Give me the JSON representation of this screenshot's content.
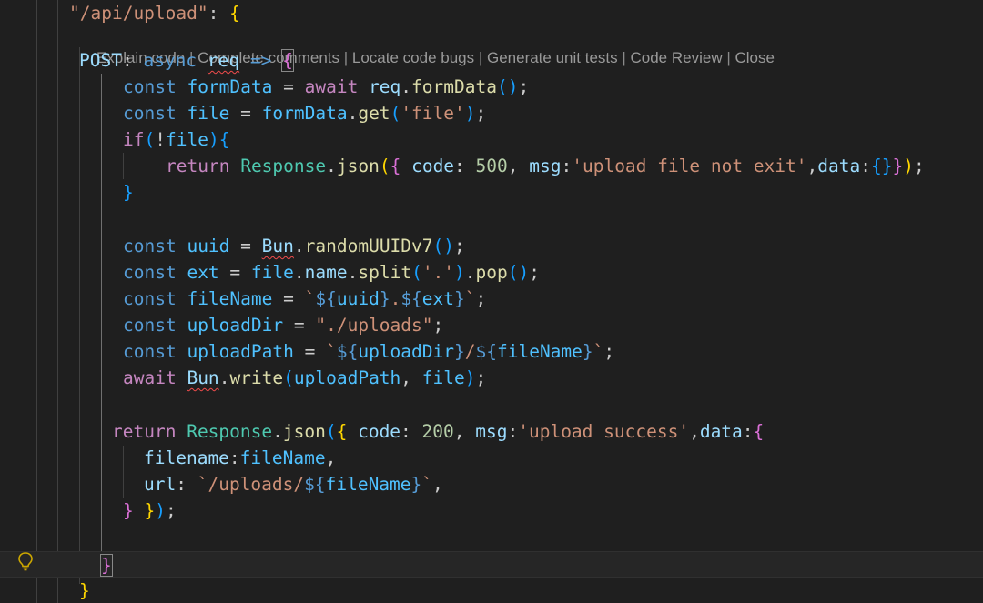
{
  "codelens": {
    "items": [
      "Explain code",
      "Complete comments",
      "Locate code bugs",
      "Generate unit tests",
      "Code Review",
      "Close"
    ],
    "separator": " | "
  },
  "code": {
    "l1_str": "\"/api/upload\"",
    "l1_colon": ": ",
    "l1_brace": "{",
    "l2_post": "POST",
    "l2_colon": ": ",
    "l2_async": "async",
    "l2_req": "req",
    "l2_arrow": "=>",
    "l2_brace": "{",
    "l3_const": "const",
    "l3_formData": "formData",
    "l3_eq": " = ",
    "l3_await": "await",
    "l3_req": "req",
    "l3_dot": ".",
    "l3_fn": "formData",
    "l3_parens": "()",
    "l3_semi": ";",
    "l4_const": "const",
    "l4_file": "file",
    "l4_eq": " = ",
    "l4_formData": "formData",
    "l4_dot": ".",
    "l4_get": "get",
    "l4_open": "(",
    "l4_arg": "'file'",
    "l4_close": ")",
    "l4_semi": ";",
    "l5_if": "if",
    "l5_open": "(",
    "l5_not": "!",
    "l5_file": "file",
    "l5_close": ")",
    "l5_brace": "{",
    "l6_return": "return",
    "l6_Response": "Response",
    "l6_dot": ".",
    "l6_json": "json",
    "l6_open": "(",
    "l6_brace": "{",
    "l6_code": " code",
    "l6_colon1": ": ",
    "l6_500": "500",
    "l6_comma1": ", ",
    "l6_msg": "msg",
    "l6_colon2": ":",
    "l6_msgstr": "'upload file not exit'",
    "l6_comma2": ",",
    "l6_data": "data",
    "l6_colon3": ":",
    "l6_obj": "{}",
    "l6_brace_close": "}",
    "l6_close": ")",
    "l6_semi": ";",
    "l7_brace": "}",
    "l9_const": "const",
    "l9_uuid": "uuid",
    "l9_eq": " = ",
    "l9_Bun": "Bun",
    "l9_dot": ".",
    "l9_fn": "randomUUIDv7",
    "l9_parens": "()",
    "l9_semi": ";",
    "l10_const": "const",
    "l10_ext": "ext",
    "l10_eq": " = ",
    "l10_file": "file",
    "l10_dot1": ".",
    "l10_name": "name",
    "l10_dot2": ".",
    "l10_split": "split",
    "l10_open": "(",
    "l10_arg": "'.'",
    "l10_close": ")",
    "l10_dot3": ".",
    "l10_pop": "pop",
    "l10_parens": "()",
    "l10_semi": ";",
    "l11_const": "const",
    "l11_fileName": "fileName",
    "l11_eq": " = ",
    "l11_tick1": "`",
    "l11_d1": "${",
    "l11_uuid": "uuid",
    "l11_c1": "}",
    "l11_dot": ".",
    "l11_d2": "${",
    "l11_ext": "ext",
    "l11_c2": "}",
    "l11_tick2": "`",
    "l11_semi": ";",
    "l12_const": "const",
    "l12_uploadDir": "uploadDir",
    "l12_eq": " = ",
    "l12_str": "\"./uploads\"",
    "l12_semi": ";",
    "l13_const": "const",
    "l13_uploadPath": "uploadPath",
    "l13_eq": " = ",
    "l13_tick1": "`",
    "l13_d1": "${",
    "l13_uploadDir": "uploadDir",
    "l13_c1": "}",
    "l13_slash": "/",
    "l13_d2": "${",
    "l13_fileName": "fileName",
    "l13_c2": "}",
    "l13_tick2": "`",
    "l13_semi": ";",
    "l14_await": "await",
    "l14_Bun": "Bun",
    "l14_dot": ".",
    "l14_write": "write",
    "l14_open": "(",
    "l14_uploadPath": "uploadPath",
    "l14_comma": ", ",
    "l14_file": "file",
    "l14_close": ")",
    "l14_semi": ";",
    "l16_return": "return",
    "l16_Response": "Response",
    "l16_dot": ".",
    "l16_json": "json",
    "l16_open": "(",
    "l16_brace": "{",
    "l16_code": " code",
    "l16_colon1": ": ",
    "l16_200": "200",
    "l16_comma1": ", ",
    "l16_msg": "msg",
    "l16_colon2": ":",
    "l16_msgstr": "'upload success'",
    "l16_comma2": ",",
    "l16_data": "data",
    "l16_colon3": ":",
    "l16_obj": "{",
    "l17_filename": "filename",
    "l17_colon": ":",
    "l17_fileName": "fileName",
    "l17_comma": ",",
    "l18_url": "url",
    "l18_colon": ": ",
    "l18_tick1": "`/uploads/",
    "l18_d": "${",
    "l18_fileName": "fileName",
    "l18_c": "}",
    "l18_tick2": "`",
    "l18_comma": ",",
    "l19_brace1": "}",
    "l19_brace2": "}",
    "l19_close": ")",
    "l19_semi": ";",
    "l21_brace": "}",
    "l22_brace": "}"
  },
  "colors": {
    "background": "#1f1f1f",
    "keyword": "#569cd6",
    "control": "#c586c0",
    "variable": "#9cdcfe",
    "constant": "#4fc1ff",
    "function": "#dcdcaa",
    "class": "#4ec9b0",
    "string": "#ce9178",
    "number": "#b5cea8",
    "bracket1": "#ffd700",
    "bracket2": "#da70d6",
    "bracket3": "#179fff",
    "error_squiggle": "#f14c4c"
  },
  "icons": {
    "gutter": "lightbulb-icon"
  }
}
